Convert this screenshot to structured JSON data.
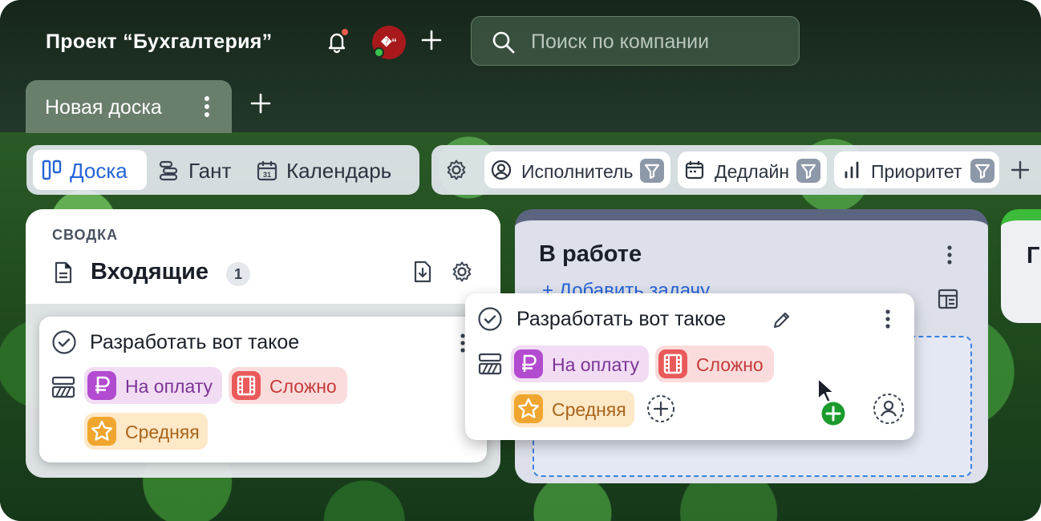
{
  "header": {
    "project_title": "Проект “Бухгалтерия”",
    "avatar_text": "�“",
    "search_placeholder": "Поиск по компании"
  },
  "tabs": [
    {
      "label": "Новая доска"
    }
  ],
  "views": [
    {
      "label": "Доска",
      "icon": "board-icon",
      "active": true
    },
    {
      "label": "Гант",
      "icon": "gantt-icon",
      "active": false
    },
    {
      "label": "Календарь",
      "icon": "calendar-icon",
      "active": false
    }
  ],
  "filters": [
    {
      "label": "Исполнитель",
      "icon": "user-circle-icon"
    },
    {
      "label": "Дедлайн",
      "icon": "calendar-icon"
    },
    {
      "label": "Приоритет",
      "icon": "bar-chart-icon"
    }
  ],
  "columns": [
    {
      "overline": "СВОДКА",
      "title": "Входящие",
      "count": "1"
    },
    {
      "title": "В работе",
      "add_label": "+ Добавить задачу"
    },
    {
      "title": "Г"
    }
  ],
  "cards": [
    {
      "title": "Разработать вот такое",
      "tags": [
        {
          "label": "На оплату",
          "icon": "ruble-icon"
        },
        {
          "label": "Сложно",
          "icon": "film-icon"
        },
        {
          "label": "Средняя",
          "icon": "star-icon"
        }
      ]
    },
    {
      "title": "Разработать вот такое",
      "tags": [
        {
          "label": "На оплату",
          "icon": "ruble-icon"
        },
        {
          "label": "Сложно",
          "icon": "film-icon"
        },
        {
          "label": "Средняя",
          "icon": "star-icon"
        }
      ]
    }
  ],
  "colors": {
    "accent": "#2563d8",
    "tag_pay": "#b24bd0",
    "tag_hard": "#ea5a5a",
    "tag_mid": "#f0a62e",
    "green_column": "#3dbb3a"
  }
}
